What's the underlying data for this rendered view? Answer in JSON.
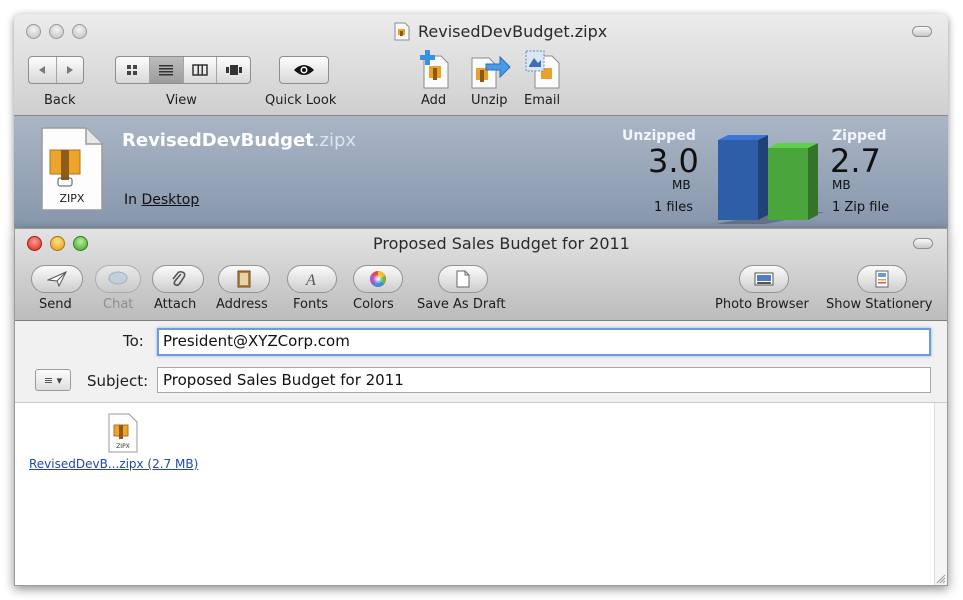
{
  "zip_window": {
    "title": "RevisedDevBudget.zipx",
    "toolbar": {
      "back_label": "Back",
      "view_label": "View",
      "quicklook_label": "Quick Look",
      "add_label": "Add",
      "unzip_label": "Unzip",
      "email_label": "Email",
      "view_modes": [
        "icon-view-icon",
        "list-view-icon",
        "column-view-icon",
        "coverflow-view-icon"
      ],
      "active_view_mode": "list"
    },
    "info": {
      "file_base": "RevisedDevBudget",
      "file_ext": ".zipx",
      "file_type_label": "ZIPX",
      "location_prefix": "In",
      "location": "Desktop",
      "unzipped_label": "Unzipped",
      "unzipped_value": "3.0",
      "unzipped_unit": "MB",
      "unzipped_count": "1 files",
      "zipped_label": "Zipped",
      "zipped_value": "2.7",
      "zipped_unit": "MB",
      "zipped_count": "1 Zip file",
      "unzipped_bar_color": "#2f5ea8",
      "zipped_bar_color": "#4aa63c"
    }
  },
  "mail_window": {
    "title": "Proposed Sales Budget for 2011",
    "toolbar": {
      "send": "Send",
      "chat": "Chat",
      "attach": "Attach",
      "address": "Address",
      "fonts": "Fonts",
      "colors": "Colors",
      "save_as_draft": "Save As Draft",
      "photo_browser": "Photo Browser",
      "show_stationery": "Show Stationery"
    },
    "headers": {
      "to_label": "To:",
      "to_value": "President@XYZCorp.com",
      "subject_label": "Subject:",
      "subject_value": "Proposed Sales Budget for 2011",
      "account_menu_glyph": "≡ ▾"
    },
    "body": {
      "attachment_link": "RevisedDevB...zipx (2.7 MB)",
      "attachment_icon_label": "ZIPX"
    }
  }
}
